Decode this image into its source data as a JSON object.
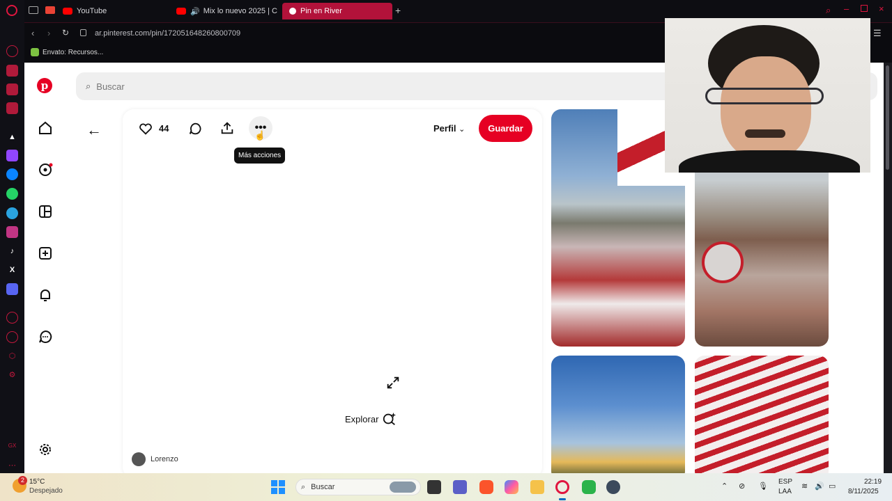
{
  "browser": {
    "tabs": [
      {
        "label": "YouTube"
      },
      {
        "label": "Mix lo nuevo 2025 | C"
      },
      {
        "label": "Pin en River"
      }
    ],
    "url": "ar.pinterest.com/pin/172051648260800709",
    "bookmark": "Envato: Recursos..."
  },
  "pinterest": {
    "search_placeholder": "Buscar",
    "likes": "44",
    "profile_label": "Perfil",
    "save_label": "Guardar",
    "tooltip": "Más acciones",
    "explore_label": "Explorar",
    "author": "Lorenzo"
  },
  "taskbar": {
    "weather_temp": "15°C",
    "weather_desc": "Despejado",
    "weather_badge": "2",
    "search_label": "Buscar",
    "lang_line1": "ESP",
    "lang_line2": "LAA",
    "time": "22:19",
    "date": "8/11/2025"
  },
  "colors": {
    "pinterest_red": "#e60023",
    "opera_red": "#b2123a",
    "dark_bg": "#0b0b0f"
  }
}
